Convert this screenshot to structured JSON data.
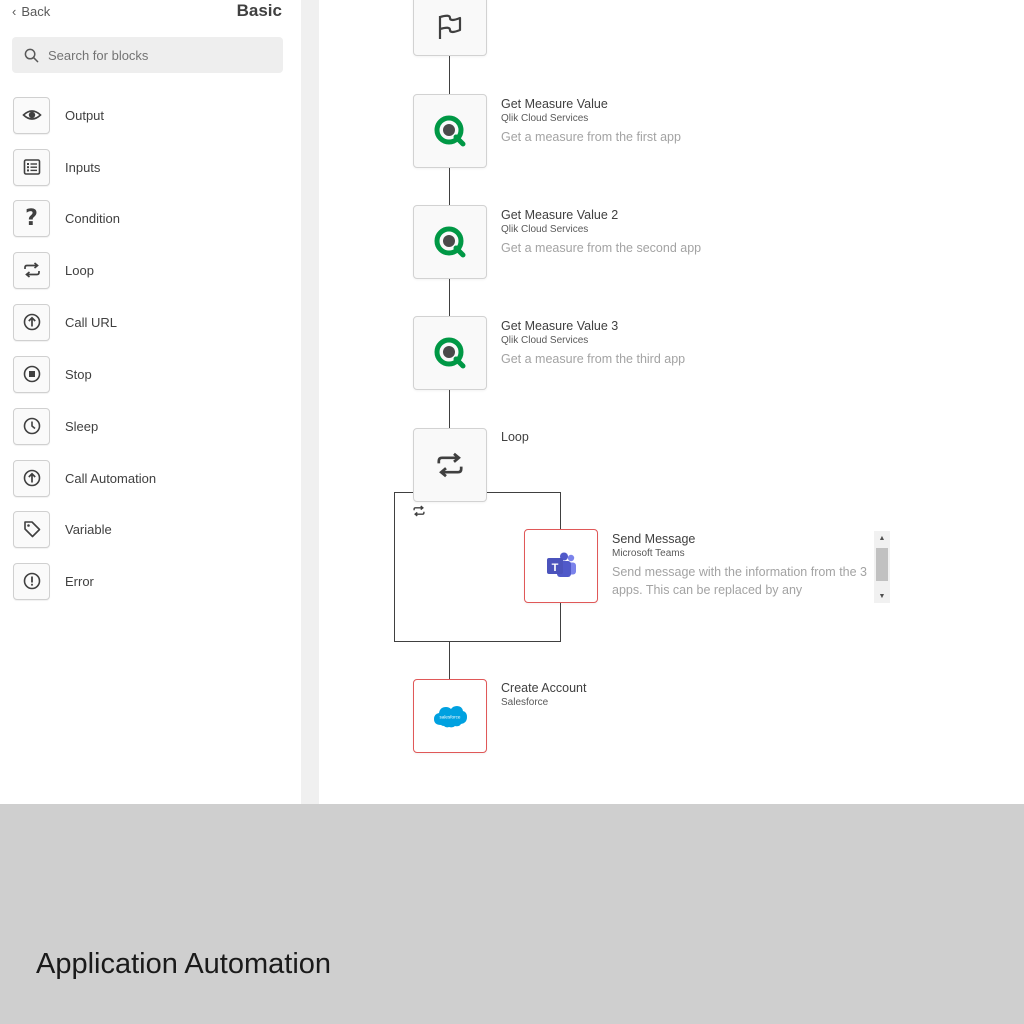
{
  "sidebar": {
    "back_label": "Back",
    "title": "Basic",
    "search_placeholder": "Search for blocks",
    "items": [
      {
        "label": "Output",
        "icon": "eye-icon"
      },
      {
        "label": "Inputs",
        "icon": "form-icon"
      },
      {
        "label": "Condition",
        "icon": "question-icon"
      },
      {
        "label": "Loop",
        "icon": "loop-icon"
      },
      {
        "label": "Call URL",
        "icon": "arrow-up-circle-icon"
      },
      {
        "label": "Stop",
        "icon": "stop-icon"
      },
      {
        "label": "Sleep",
        "icon": "clock-icon"
      },
      {
        "label": "Call Automation",
        "icon": "arrow-up-circle-icon"
      },
      {
        "label": "Variable",
        "icon": "tag-icon"
      },
      {
        "label": "Error",
        "icon": "exclamation-icon"
      }
    ]
  },
  "canvas": {
    "nodes": [
      {
        "id": "start",
        "icon": "flag-icon"
      },
      {
        "id": "gmv1",
        "title": "Get Measure Value",
        "subtitle": "Qlik Cloud Services",
        "description": "Get a measure from the first app",
        "icon": "qlik-icon"
      },
      {
        "id": "gmv2",
        "title": "Get Measure Value 2",
        "subtitle": "Qlik Cloud Services",
        "description": "Get a measure from the second app",
        "icon": "qlik-icon"
      },
      {
        "id": "gmv3",
        "title": "Get Measure Value 3",
        "subtitle": "Qlik Cloud Services",
        "description": "Get a measure from the third app",
        "icon": "qlik-icon"
      },
      {
        "id": "loop",
        "title": "Loop",
        "icon": "loop-icon"
      },
      {
        "id": "send",
        "title": "Send Message",
        "subtitle": "Microsoft Teams",
        "description_line1": "Send message with the information from the 3",
        "description_line2": "apps. This can be replaced by any",
        "icon": "teams-icon"
      },
      {
        "id": "create",
        "title": "Create Account",
        "subtitle": "Salesforce",
        "icon": "salesforce-icon",
        "salesforce_text": "salesforce"
      }
    ]
  },
  "colors": {
    "qlik_green": "#009845",
    "teams_purple": "#5059c9",
    "salesforce_blue": "#00a1e0",
    "error_border": "#e05858"
  },
  "caption": "Application Automation"
}
